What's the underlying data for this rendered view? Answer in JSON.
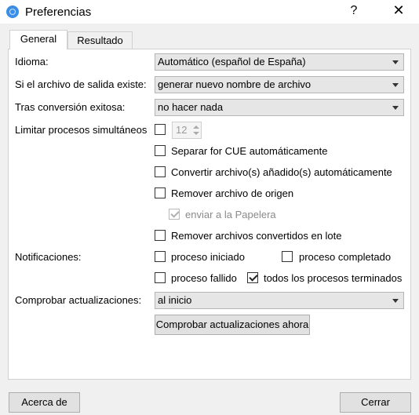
{
  "window": {
    "title": "Preferencias",
    "help": "?",
    "close": "✕"
  },
  "tabs": [
    {
      "label": "General"
    },
    {
      "label": "Resultado"
    }
  ],
  "general": {
    "idioma_label": "Idioma:",
    "idioma_value": "Automático (español de España)",
    "salida_label": "Si el archivo de salida existe:",
    "salida_value": "generar nuevo nombre de archivo",
    "tras_label": "Tras conversión exitosa:",
    "tras_value": "no hacer nada",
    "limitar_label": "Limitar procesos simultáneos",
    "limitar_value": "12",
    "separar_cue": "Separar for CUE automáticamente",
    "convertir_auto": "Convertir archivo(s) añadido(s) automáticamente",
    "remover_origen": "Remover archivo de origen",
    "enviar_papelera": "enviar a la Papelera",
    "remover_lote": "Remover archivos convertidos en lote",
    "notificaciones_label": "Notificaciones:",
    "proceso_iniciado": "proceso iniciado",
    "proceso_completado": "proceso completado",
    "proceso_fallido": "proceso fallido",
    "todos_terminados": "todos los procesos terminados",
    "actualizaciones_label": "Comprobar actualizaciones:",
    "actualizaciones_value": "al inicio",
    "comprobar_ahora": "Comprobar actualizaciones ahora"
  },
  "footer": {
    "acerca": "Acerca de",
    "cerrar": "Cerrar"
  },
  "icons": {
    "app": "app-logo-icon",
    "dropdown": "chevron-down-icon"
  }
}
